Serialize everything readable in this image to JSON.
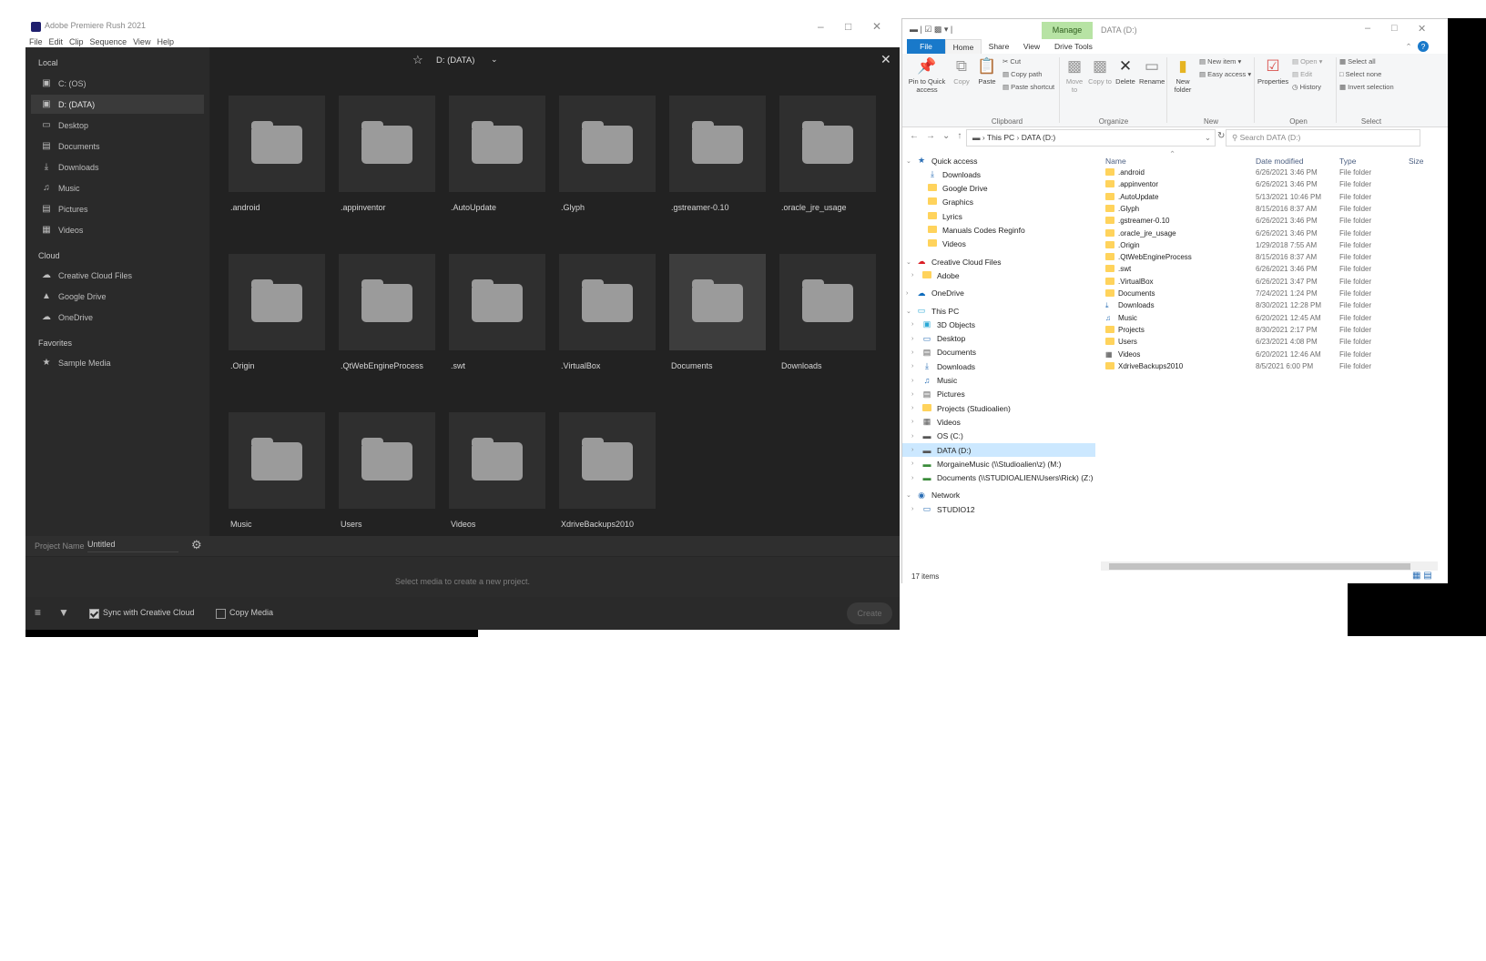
{
  "rush": {
    "title": "Adobe Premiere Rush 2021",
    "menus": [
      "File",
      "Edit",
      "Clip",
      "Sequence",
      "View",
      "Help"
    ],
    "location": "D: (DATA)",
    "sidebar": {
      "local_title": "Local",
      "local": [
        {
          "label": "C: (OS)",
          "icon": "drive-icon"
        },
        {
          "label": "D: (DATA)",
          "icon": "drive-icon"
        },
        {
          "label": "Desktop",
          "icon": "desktop-icon"
        },
        {
          "label": "Documents",
          "icon": "document-icon"
        },
        {
          "label": "Downloads",
          "icon": "download-icon"
        },
        {
          "label": "Music",
          "icon": "music-icon"
        },
        {
          "label": "Pictures",
          "icon": "picture-icon"
        },
        {
          "label": "Videos",
          "icon": "video-icon"
        }
      ],
      "cloud_title": "Cloud",
      "cloud": [
        {
          "label": "Creative Cloud Files",
          "icon": "creative-cloud-icon"
        },
        {
          "label": "Google Drive",
          "icon": "google-drive-icon"
        },
        {
          "label": "OneDrive",
          "icon": "cloud-icon"
        }
      ],
      "favorites_title": "Favorites",
      "favorites": [
        {
          "label": "Sample Media",
          "icon": "star-icon"
        }
      ]
    },
    "folders": [
      ".android",
      ".appinventor",
      ".AutoUpdate",
      ".Glyph",
      ".gstreamer-0.10",
      ".oracle_jre_usage",
      ".Origin",
      ".QtWebEngineProcess",
      ".swt",
      ".VirtualBox",
      "Documents",
      "Downloads",
      "Music",
      "Users",
      "Videos",
      "XdriveBackups2010"
    ],
    "project_name_label": "Project Name",
    "project_name_value": "Untitled",
    "select_media_hint": "Select media to create a new project.",
    "sync_label": "Sync with Creative Cloud",
    "sync_checked": true,
    "copy_media_label": "Copy Media",
    "copy_media_checked": false,
    "create_label": "Create"
  },
  "explorer": {
    "title": "DATA (D:)",
    "manage_tab": "Manage",
    "tabs": [
      "File",
      "Home",
      "Share",
      "View",
      "Drive Tools"
    ],
    "ribbon": {
      "pin_label": "Pin to Quick access",
      "copy_label": "Copy",
      "paste_label": "Paste",
      "cut_label": "Cut",
      "copy_path_label": "Copy path",
      "paste_shortcut_label": "Paste shortcut",
      "clipboard_group": "Clipboard",
      "move_to_label": "Move to",
      "copy_to_label": "Copy to",
      "delete_label": "Delete",
      "rename_label": "Rename",
      "organize_group": "Organize",
      "new_folder_label": "New folder",
      "new_item_label": "New item",
      "easy_access_label": "Easy access",
      "new_group": "New",
      "properties_label": "Properties",
      "open_label": "Open",
      "edit_label": "Edit",
      "history_label": "History",
      "open_group": "Open",
      "select_all_label": "Select all",
      "select_none_label": "Select none",
      "invert_selection_label": "Invert selection",
      "select_group": "Select"
    },
    "address_parts": [
      "This PC",
      "DATA (D:)"
    ],
    "search_placeholder": "Search DATA (D:)",
    "nav": {
      "quick_access": "Quick access",
      "quick_items": [
        "Downloads",
        "Google Drive",
        "Graphics",
        "Lyrics",
        "Manuals Codes Reginfo",
        "Videos"
      ],
      "ccf": "Creative Cloud Files",
      "ccf_items": [
        "Adobe"
      ],
      "onedrive": "OneDrive",
      "this_pc": "This PC",
      "pc_items": [
        "3D Objects",
        "Desktop",
        "Documents",
        "Downloads",
        "Music",
        "Pictures",
        "Projects (Studioalien)",
        "Videos",
        "OS (C:)",
        "DATA (D:)",
        "MorgaineMusic (\\\\Studioalien\\z) (M:)",
        "Documents (\\\\STUDIOALIEN\\Users\\Rick) (Z:)"
      ],
      "network": "Network",
      "network_items": [
        "STUDIO12"
      ]
    },
    "columns": {
      "name": "Name",
      "date": "Date modified",
      "type": "Type",
      "size": "Size"
    },
    "files": [
      {
        "name": ".android",
        "date": "6/26/2021 3:46 PM",
        "type": "File folder",
        "icon": "folder"
      },
      {
        "name": ".appinventor",
        "date": "6/26/2021 3:46 PM",
        "type": "File folder",
        "icon": "folder"
      },
      {
        "name": ".AutoUpdate",
        "date": "5/13/2021 10:46 PM",
        "type": "File folder",
        "icon": "folder"
      },
      {
        "name": ".Glyph",
        "date": "8/15/2016 8:37 AM",
        "type": "File folder",
        "icon": "folder"
      },
      {
        "name": ".gstreamer-0.10",
        "date": "6/26/2021 3:46 PM",
        "type": "File folder",
        "icon": "folder"
      },
      {
        "name": ".oracle_jre_usage",
        "date": "6/26/2021 3:46 PM",
        "type": "File folder",
        "icon": "folder"
      },
      {
        "name": ".Origin",
        "date": "1/29/2018 7:55 AM",
        "type": "File folder",
        "icon": "folder"
      },
      {
        "name": ".QtWebEngineProcess",
        "date": "8/15/2016 8:37 AM",
        "type": "File folder",
        "icon": "folder"
      },
      {
        "name": ".swt",
        "date": "6/26/2021 3:46 PM",
        "type": "File folder",
        "icon": "folder"
      },
      {
        "name": ".VirtualBox",
        "date": "6/26/2021 3:47 PM",
        "type": "File folder",
        "icon": "folder"
      },
      {
        "name": "Documents",
        "date": "7/24/2021 1:24 PM",
        "type": "File folder",
        "icon": "folder"
      },
      {
        "name": "Downloads",
        "date": "8/30/2021 12:28 PM",
        "type": "File folder",
        "icon": "download"
      },
      {
        "name": "Music",
        "date": "6/20/2021 12:45 AM",
        "type": "File folder",
        "icon": "music"
      },
      {
        "name": "Projects",
        "date": "8/30/2021 2:17 PM",
        "type": "File folder",
        "icon": "folder"
      },
      {
        "name": "Users",
        "date": "6/23/2021 4:08 PM",
        "type": "File folder",
        "icon": "folder"
      },
      {
        "name": "Videos",
        "date": "6/20/2021 12:46 AM",
        "type": "File folder",
        "icon": "video"
      },
      {
        "name": "XdriveBackups2010",
        "date": "8/5/2021 6:00 PM",
        "type": "File folder",
        "icon": "folder"
      }
    ],
    "status": "17 items"
  }
}
